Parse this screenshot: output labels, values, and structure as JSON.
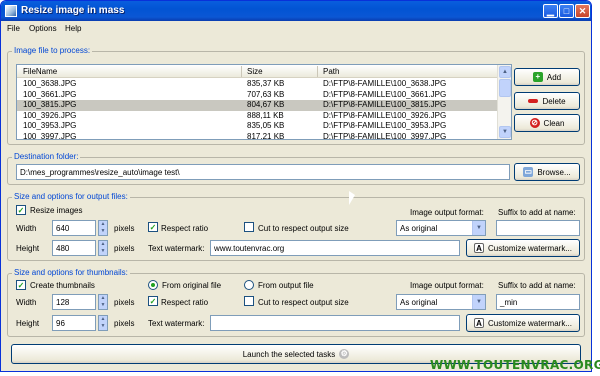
{
  "window": {
    "title": "Resize image in mass"
  },
  "menu": [
    "File",
    "Options",
    "Help"
  ],
  "images_group": {
    "legend": "Image file to process:",
    "columns": [
      "FileName",
      "Size",
      "Path"
    ],
    "rows": [
      {
        "name": "100_3638.JPG",
        "size": "835,37 KB",
        "path": "D:\\FTP\\8-FAMILLE\\100_3638.JPG"
      },
      {
        "name": "100_3661.JPG",
        "size": "707,63 KB",
        "path": "D:\\FTP\\8-FAMILLE\\100_3661.JPG"
      },
      {
        "name": "100_3815.JPG",
        "size": "804,67 KB",
        "path": "D:\\FTP\\8-FAMILLE\\100_3815.JPG"
      },
      {
        "name": "100_3926.JPG",
        "size": "888,11 KB",
        "path": "D:\\FTP\\8-FAMILLE\\100_3926.JPG"
      },
      {
        "name": "100_3953.JPG",
        "size": "835,05 KB",
        "path": "D:\\FTP\\8-FAMILLE\\100_3953.JPG"
      },
      {
        "name": "100_3997.JPG",
        "size": "817,21 KB",
        "path": "D:\\FTP\\8-FAMILLE\\100_3997.JPG"
      }
    ],
    "selected_index": 2,
    "add": "Add",
    "delete": "Delete",
    "clean": "Clean"
  },
  "destination": {
    "legend": "Destination folder:",
    "value": "D:\\mes_programmes\\resize_auto\\image test\\",
    "browse": "Browse..."
  },
  "output": {
    "legend": "Size and options for output files:",
    "resize_label": "Resize images",
    "resize_checked": true,
    "width_label": "Width",
    "width_value": "640",
    "height_label": "Height",
    "height_value": "480",
    "unit": "pixels",
    "respect_ratio": "Respect ratio",
    "respect_ratio_checked": true,
    "cut": "Cut to respect output size",
    "cut_checked": false,
    "format_label": "Image output format:",
    "format_value": "As original",
    "suffix_label": "Suffix to add at name:",
    "suffix_value": "",
    "watermark_label": "Text watermark:",
    "watermark_value": "www.toutenvrac.org",
    "customize": "Customize watermark..."
  },
  "thumbs": {
    "legend": "Size and options for thumbnails:",
    "create_label": "Create thumbnails",
    "create_checked": true,
    "from_original": "From original file",
    "from_output": "From output file",
    "width_label": "Width",
    "width_value": "128",
    "height_label": "Height",
    "height_value": "96",
    "unit": "pixels",
    "respect_ratio": "Respect ratio",
    "respect_ratio_checked": true,
    "cut": "Cut to respect output size",
    "cut_checked": false,
    "format_label": "Image output format:",
    "format_value": "As original",
    "suffix_label": "Suffix to add at name:",
    "suffix_value": "_min",
    "watermark_label": "Text watermark:",
    "watermark_value": "",
    "customize": "Customize watermark..."
  },
  "launch": "Launch the selected tasks",
  "site_watermark": "WWW.TOUTENVRAC.ORG",
  "colors": {
    "title_blue": "#0254d3",
    "legend_blue": "#0046d5",
    "check_green": "#21a121",
    "watermark_green": "#2a8a1e"
  }
}
